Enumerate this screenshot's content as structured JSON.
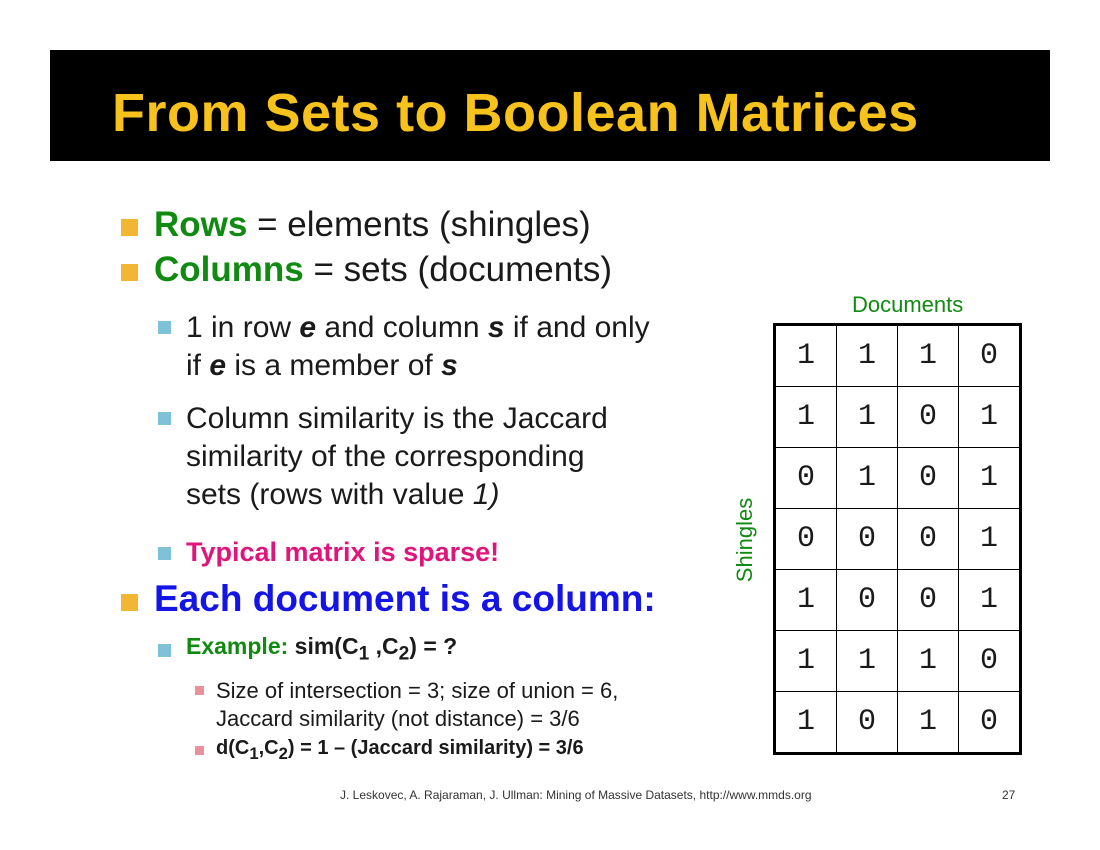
{
  "slide": {
    "title": "From Sets to Boolean Matrices",
    "footer": "J. Leskovec, A. Rajaraman, J. Ullman: Mining of Massive Datasets, http://www.mmds.org",
    "page_number": "27"
  },
  "bullets": {
    "rows": {
      "term": "Rows",
      "rest": " = elements (shingles)"
    },
    "columns": {
      "term": "Columns",
      "rest": " = sets (documents)"
    },
    "membership": {
      "p1": "1 in row ",
      "e": "e",
      "p2": " and column ",
      "s": "s",
      "p3": " if and only",
      "p4": "if ",
      "e2": "e",
      "p5": " is a member of ",
      "s2": "s"
    },
    "similarity": {
      "line1": "Column similarity is the Jaccard",
      "line2": "similarity of the corresponding",
      "line3_a": "sets (rows with value ",
      "line3_b": "1)"
    },
    "sparse": "Typical matrix is sparse!",
    "each_doc": "Each document is a column:",
    "example": {
      "label": "Example: ",
      "sim": "sim(C",
      "sub1": "1",
      "mid": " ,C",
      "sub2": "2",
      "end": ") = ?"
    },
    "intersection": {
      "line1": "Size of intersection = 3; size of union = 6,",
      "line2": "Jaccard similarity (not distance) = 3/6"
    },
    "distance": {
      "a": "d(C",
      "sub1": "1",
      "b": ",C",
      "sub2": "2",
      "c": ") = 1 – (Jaccard similarity) = 3/6"
    }
  },
  "matrix": {
    "column_label": "Documents",
    "row_label": "Shingles",
    "rows": [
      [
        "1",
        "1",
        "1",
        "0"
      ],
      [
        "1",
        "1",
        "0",
        "1"
      ],
      [
        "0",
        "1",
        "0",
        "1"
      ],
      [
        "0",
        "0",
        "0",
        "1"
      ],
      [
        "1",
        "0",
        "0",
        "1"
      ],
      [
        "1",
        "1",
        "1",
        "0"
      ],
      [
        "1",
        "0",
        "1",
        "0"
      ]
    ]
  },
  "colors": {
    "title_bar": "#000000",
    "title_text": "#f7c21c",
    "green": "#108a10",
    "pink": "#e0157a",
    "blue": "#1414e6"
  }
}
